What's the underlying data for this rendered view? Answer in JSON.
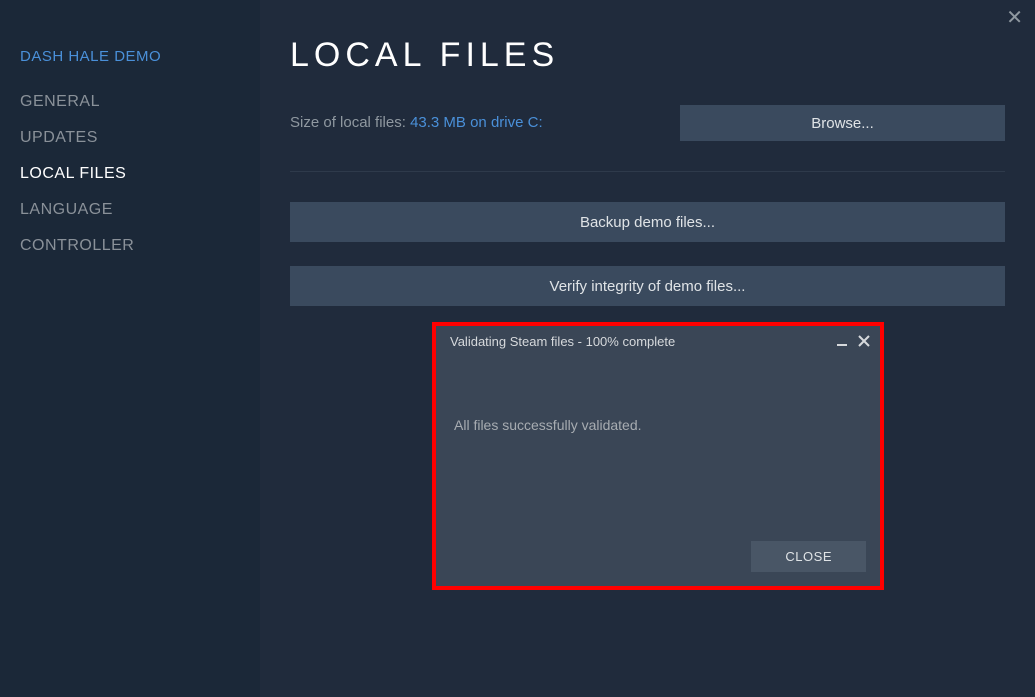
{
  "sidebar": {
    "title": "DASH HALE DEMO",
    "items": [
      {
        "label": "GENERAL",
        "active": false
      },
      {
        "label": "UPDATES",
        "active": false
      },
      {
        "label": "LOCAL FILES",
        "active": true
      },
      {
        "label": "LANGUAGE",
        "active": false
      },
      {
        "label": "CONTROLLER",
        "active": false
      }
    ]
  },
  "main": {
    "title": "LOCAL FILES",
    "size_label": "Size of local files: ",
    "size_value": "43.3 MB on drive C:",
    "browse_label": "Browse...",
    "backup_label": "Backup demo files...",
    "verify_label": "Verify integrity of demo files..."
  },
  "dialog": {
    "title": "Validating Steam files - 100% complete",
    "message": "All files successfully validated.",
    "close_label": "CLOSE"
  },
  "close_glyph": "✕"
}
